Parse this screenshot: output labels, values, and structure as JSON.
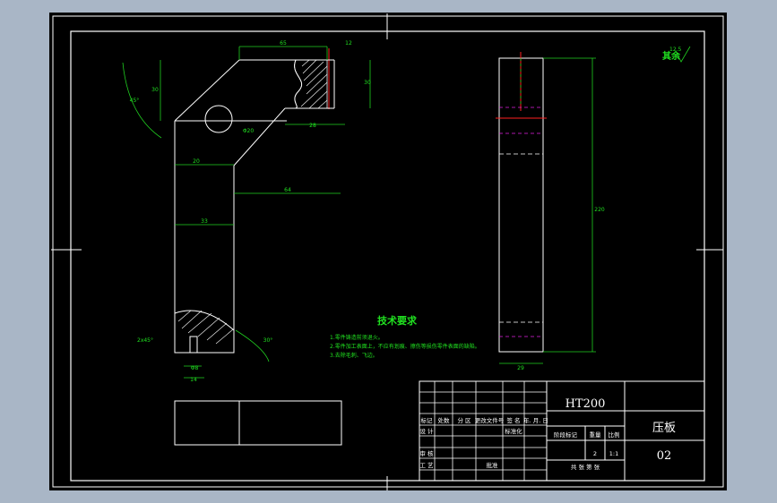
{
  "drawing": {
    "title_block": {
      "material": "HT200",
      "part_name": "压板",
      "drawing_no": "02",
      "scale": "1:1",
      "quantity": "2",
      "header_row": [
        "标记",
        "处数",
        "分 区",
        "更改文件号",
        "签 名",
        "年. 月. 日"
      ],
      "design_row": [
        "设 计",
        "",
        "标准化"
      ],
      "stage_label": "阶段标记",
      "weight_label": "重量",
      "scale_label": "比例",
      "review_label": "审 核",
      "process_label": "工 艺",
      "approve_label": "批准",
      "sheets_label": "共   张   第   张"
    },
    "surface_finish": {
      "prefix": "其余",
      "value": "12.5"
    },
    "tech_req": {
      "heading": "技术要求",
      "items": [
        "1.零件铸造前须退火。",
        "2.零件加工表面上，不应有划痕、擦伤等损伤零件表面的缺陷。",
        "3.去除毛刺、飞边。"
      ]
    },
    "dimensions": {
      "top_width": "65",
      "top_right": "12",
      "left_height": "30",
      "right_height": "30",
      "angle": "45°",
      "hole": "Φ20",
      "ledge": "28",
      "neck": "20",
      "reach": "64",
      "arm_width": "33",
      "chamfer": "2x45°",
      "pin_dia": "Φ8",
      "pin_width": "14",
      "foot_angle": "30°",
      "side_width": "29",
      "side_height": "220"
    }
  }
}
